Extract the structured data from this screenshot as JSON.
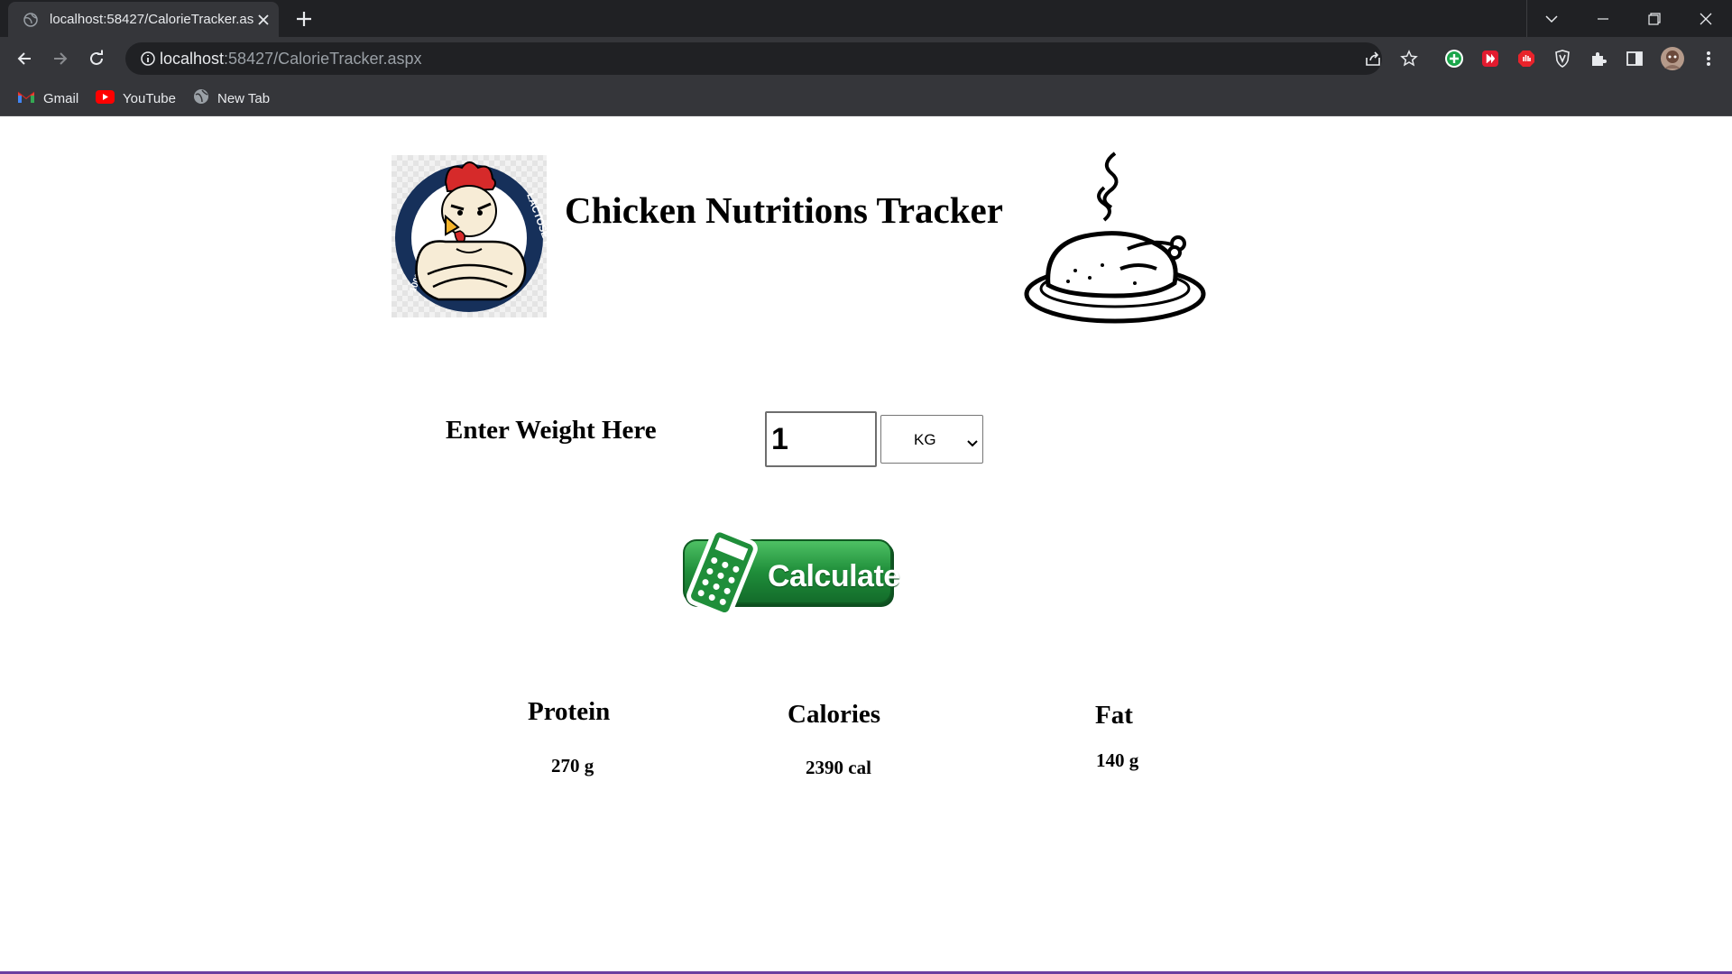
{
  "browser": {
    "tab_title": "localhost:58427/CalorieTracker.aspx",
    "url_host": "localhost",
    "url_rest": ":58427/CalorieTracker.aspx",
    "bookmarks": [
      {
        "label": "Gmail",
        "icon": "gmail-icon"
      },
      {
        "label": "YouTube",
        "icon": "youtube-icon"
      },
      {
        "label": "New Tab",
        "icon": "globe-icon"
      }
    ],
    "colors": {
      "frame": "#202124",
      "toolbar": "#35363a",
      "text": "#e8eaed"
    }
  },
  "header": {
    "title": "Chicken Nutritions Tracker",
    "logo_badge_text_left": "100% CHICKEN PROTEIN",
    "logo_badge_text_right": "LACTOSE FREE"
  },
  "form": {
    "weight_label": "Enter Weight Here",
    "weight_value": "1",
    "unit_selected": "KG",
    "calculate_label": "Calculate"
  },
  "results": {
    "protein_label": "Protein",
    "protein_value": "270 g",
    "calories_label": "Calories",
    "calories_value": "2390 cal",
    "fat_label": "Fat",
    "fat_value": "140 g"
  },
  "colors": {
    "calculate_green": "#1f8e3a",
    "accent_bottom": "#6b3fa0"
  }
}
